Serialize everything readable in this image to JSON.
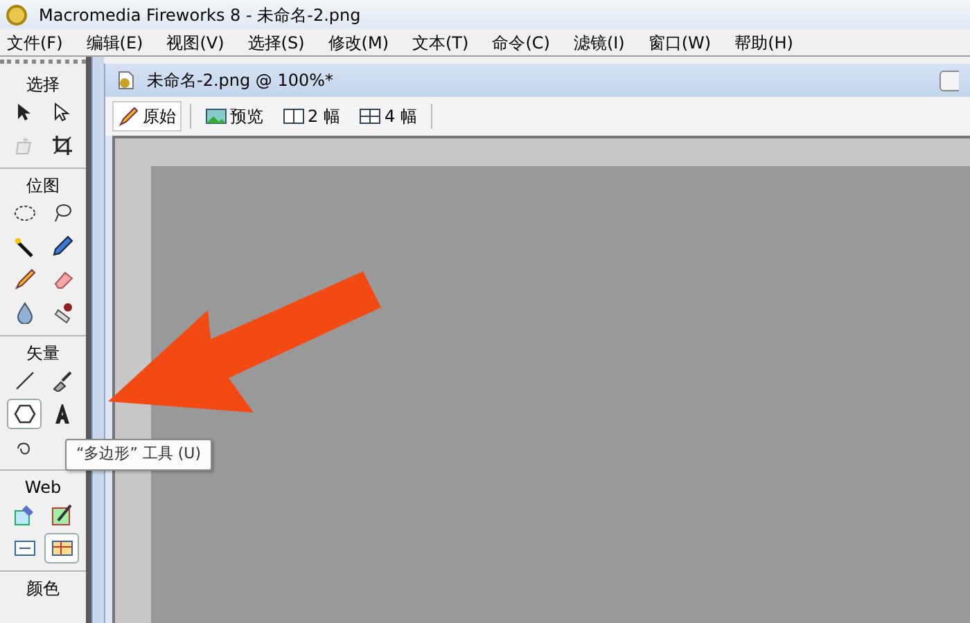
{
  "window": {
    "title": "Macromedia Fireworks 8 - 未命名-2.png"
  },
  "menu": [
    "文件(F)",
    "编辑(E)",
    "视图(V)",
    "选择(S)",
    "修改(M)",
    "文本(T)",
    "命令(C)",
    "滤镜(I)",
    "窗口(W)",
    "帮助(H)"
  ],
  "tool_sections": [
    {
      "title": "选择",
      "tools": [
        {
          "selected": false
        },
        {
          "selected": false
        },
        {
          "selected": false
        },
        {
          "selected": false
        }
      ]
    },
    {
      "title": "位图",
      "tools": [
        {
          "selected": false
        },
        {
          "selected": false
        },
        {
          "selected": false
        },
        {
          "selected": false
        },
        {
          "selected": false
        },
        {
          "selected": false
        },
        {
          "selected": false
        },
        {
          "selected": false
        }
      ]
    },
    {
      "title": "矢量",
      "tools": [
        {
          "selected": false
        },
        {
          "selected": false
        },
        {
          "selected": true
        },
        {
          "selected": false
        },
        {
          "selected": false
        }
      ]
    },
    {
      "title": "Web",
      "tools": [
        {
          "selected": false
        },
        {
          "selected": false
        },
        {
          "selected": false
        },
        {
          "selected": true
        }
      ]
    },
    {
      "title": "颜色"
    }
  ],
  "tooltip": "“多边形” 工具 (U)",
  "document": {
    "title": "未命名-2.png @ 100%*",
    "tabs": [
      {
        "label": "原始",
        "selected": true
      },
      {
        "label": "预览",
        "selected": false
      },
      {
        "label": "2 幅",
        "selected": false
      },
      {
        "label": "4 幅",
        "selected": false
      }
    ]
  }
}
